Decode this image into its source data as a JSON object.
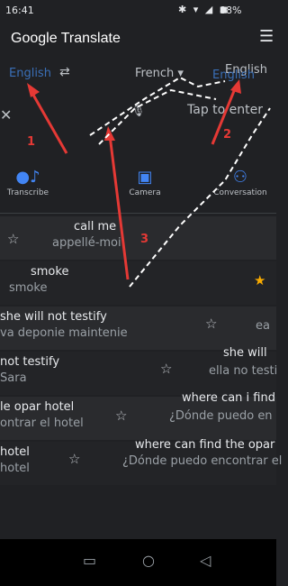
{
  "status": {
    "time": "16:41",
    "battery": "88%",
    "icons": "✱ ▾ ◢ ◼"
  },
  "app": {
    "title": "Google Translate",
    "menu_icon": "menu-icon"
  },
  "languages": {
    "source": "English",
    "target": "French",
    "target_alt": "English",
    "detected": "English"
  },
  "input": {
    "placeholder": "Tap to enter"
  },
  "tools": [
    {
      "label": "Transcribe",
      "icon": "transcribe-icon"
    },
    {
      "label": "Camera",
      "icon": "camera-icon"
    },
    {
      "label": "Conversation",
      "icon": "conversation-icon"
    }
  ],
  "history": [
    {
      "src": "call me",
      "tgt": "appellé-moi"
    },
    {
      "src": "smoke",
      "tgt": "smoke"
    },
    {
      "src": "she will not testify",
      "tgt": "va deponie maintenie"
    },
    {
      "src": "not testify",
      "tgt": "Sara"
    },
    {
      "src": "she will",
      "tgt": "ella no testi"
    },
    {
      "src": "le opar hotel",
      "tgt": "ontrar el hotel"
    },
    {
      "src": "where can i find",
      "tgt": "¿Dónde puedo en"
    },
    {
      "src": "hotel",
      "tgt": "hotel"
    },
    {
      "src": "where can find the opar",
      "tgt": "¿Dónde puedo encontrar el"
    }
  ],
  "annotations": [
    "1",
    "2",
    "3"
  ],
  "colors": {
    "accent": "#4285f4",
    "annotation": "#e53935",
    "background": "#202124"
  }
}
